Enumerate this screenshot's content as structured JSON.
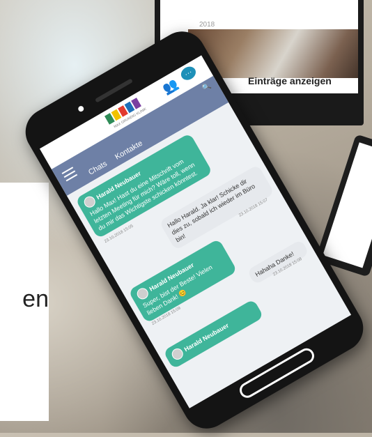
{
  "background": {
    "monitor": {
      "date": "2018",
      "entries_button": "Einträge anzeigen"
    },
    "left_card_text": "en"
  },
  "app": {
    "logo_caption": "MAX GRUNDIG KLINIK",
    "tabs": [
      "Chats",
      "Kontakte"
    ],
    "icons": {
      "menu": "hamburger-icon",
      "people": "people-icon",
      "chat": "chat-bubble-icon",
      "search": "search-icon"
    },
    "colors": {
      "nav": "#6e80a6",
      "incoming": "#3fb59a",
      "outgoing": "#e6e9ed"
    }
  },
  "messages": [
    {
      "sender": "Harald Neubauer",
      "text": "Hallo Max! Hast du eine Mitschrift vom letzten Meeting für mich? Wäre toll, wenn du mir das Wichtigste schicken könntest.",
      "time": "23.10.2018 15:05"
    },
    {
      "sender": "",
      "text": "Hallo Harald. Ja klar! Schicke dir dies zu, sobald ich wieder im Büro bin!",
      "time": "23.10.2018 15:07"
    },
    {
      "sender": "Harald Neubauer",
      "text": "Super, bist der Beste! Vielen lieben Dank! 😊",
      "time": "23.10.2018 15:09"
    },
    {
      "sender": "",
      "text": "Hahaha Danke!",
      "time": "23.10.2018 15:08"
    },
    {
      "sender": "Harald Neubauer",
      "text": "",
      "time": ""
    }
  ]
}
